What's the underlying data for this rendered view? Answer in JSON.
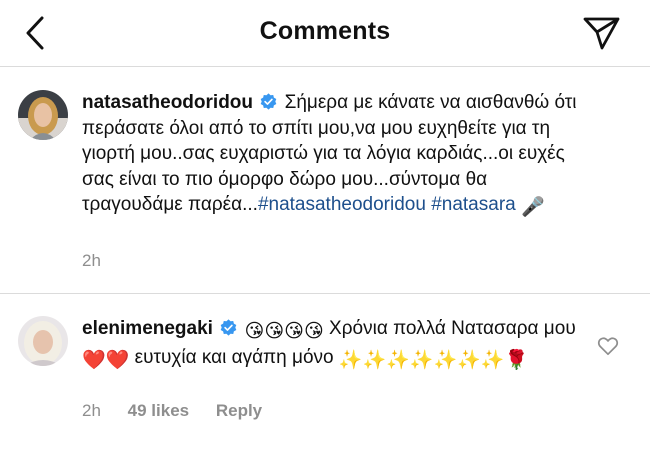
{
  "header": {
    "title": "Comments",
    "back_icon": "chevron-left-icon",
    "send_icon": "paper-plane-icon"
  },
  "colors": {
    "hashtag": "#1d4f8c",
    "verified": "#3897f0",
    "meta": "#8e8e8e",
    "divider": "#dbdbdb"
  },
  "caption": {
    "username": "natasatheodoridou",
    "text": "Σήμερα με κάνατε να αισθανθώ ότι περάσατε  όλοι από το σπίτι μου,να μου ευχηθείτε για τη γιορτή μου..σας ευχαριστώ για τα λόγια καρδιάς...οι ευχές σας είναι το πιο όμορφο δώρο μου...σύντομα θα τραγουδάμε παρέα...",
    "hashtags": [
      "#natasatheodoridou",
      "#natasara"
    ],
    "emoji": "🎤",
    "time": "2h"
  },
  "comment": {
    "username": "elenimenegaki",
    "text_part1": "Χρόνια πολλά Νατασαρα μου",
    "text_part2": "ευτυχία και αγάπη μόνο",
    "emoji_kiss": "😘",
    "emoji_heart": "❤️",
    "emoji_sparkle": "✨",
    "emoji_rose": "🌹",
    "time": "2h",
    "likes": "49 likes",
    "reply": "Reply",
    "like_icon": "heart-outline-icon"
  }
}
